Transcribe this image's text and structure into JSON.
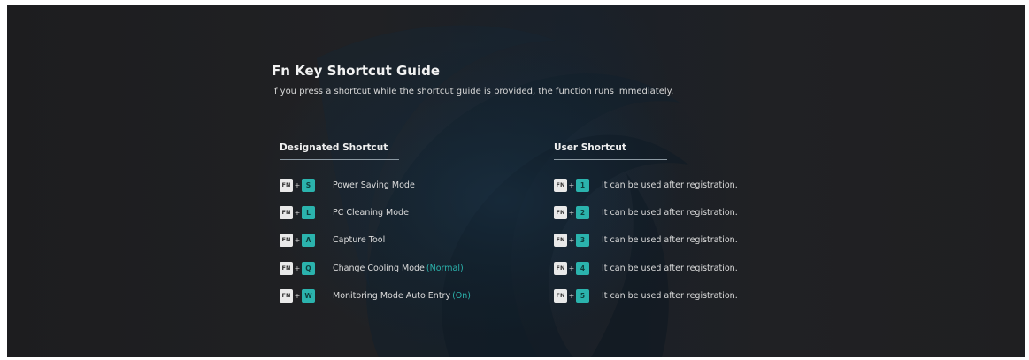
{
  "guide": {
    "title": "Fn Key Shortcut Guide",
    "subtitle": "If you press a shortcut while the shortcut guide is provided, the function runs immediately."
  },
  "designated": {
    "heading": "Designated Shortcut",
    "items": [
      {
        "fn": "FN",
        "plus": "+",
        "key": "S",
        "label": "Power Saving Mode",
        "state": ""
      },
      {
        "fn": "FN",
        "plus": "+",
        "key": "L",
        "label": "PC Cleaning Mode",
        "state": ""
      },
      {
        "fn": "FN",
        "plus": "+",
        "key": "A",
        "label": "Capture Tool",
        "state": ""
      },
      {
        "fn": "FN",
        "plus": "+",
        "key": "Q",
        "label": "Change Cooling Mode",
        "state": "(Normal)"
      },
      {
        "fn": "FN",
        "plus": "+",
        "key": "W",
        "label": "Monitoring Mode Auto Entry",
        "state": "(On)"
      }
    ]
  },
  "user": {
    "heading": "User Shortcut",
    "items": [
      {
        "fn": "FN",
        "plus": "+",
        "key": "1",
        "label": "It can be used after registration."
      },
      {
        "fn": "FN",
        "plus": "+",
        "key": "2",
        "label": "It can be used after registration."
      },
      {
        "fn": "FN",
        "plus": "+",
        "key": "3",
        "label": "It can be used after registration."
      },
      {
        "fn": "FN",
        "plus": "+",
        "key": "4",
        "label": "It can be used after registration."
      },
      {
        "fn": "FN",
        "plus": "+",
        "key": "5",
        "label": "It can be used after registration."
      }
    ]
  },
  "colors": {
    "accent": "#2bb3ad",
    "fn_key": "#e9e9e9",
    "background": "#1f1f21"
  }
}
